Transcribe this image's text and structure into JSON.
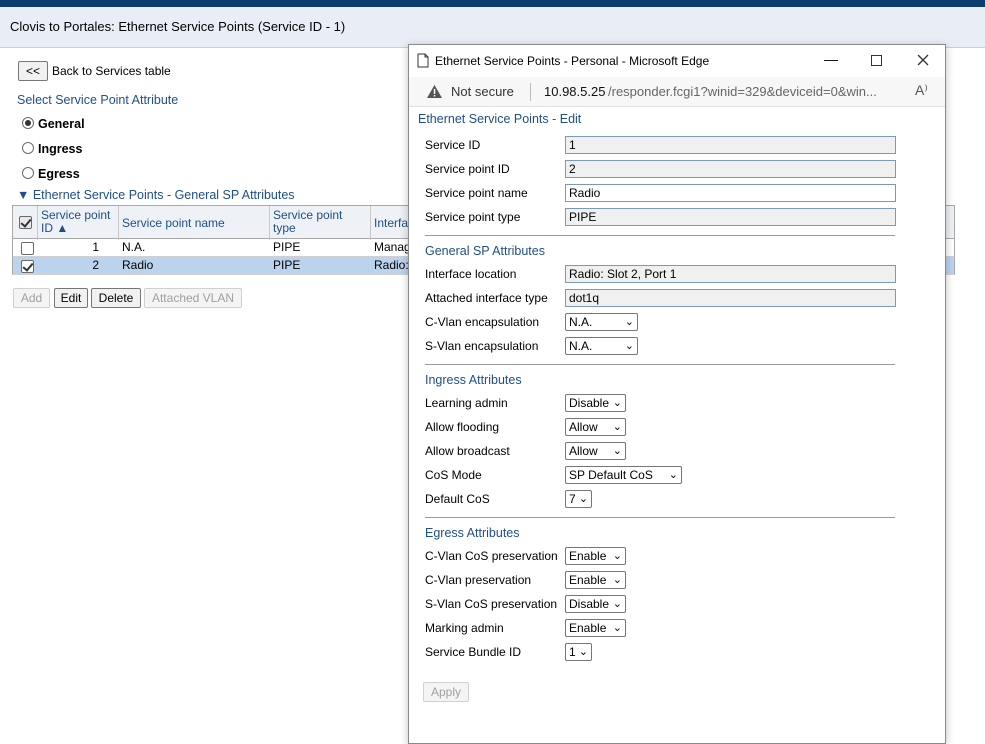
{
  "page": {
    "title": "Clovis to Portales: Ethernet Service Points (Service ID - 1)",
    "back_button": "<<",
    "back_label": "Back to Services table",
    "select_attr_title": "Select Service Point Attribute",
    "radios": [
      {
        "label": "General",
        "selected": true
      },
      {
        "label": "Ingress",
        "selected": false
      },
      {
        "label": "Egress",
        "selected": false
      }
    ],
    "section_title": "▼ Ethernet Service Points - General SP Attributes",
    "table": {
      "headers": [
        "Service point ID ▲",
        "Service point name",
        "Service point type",
        "Interfa"
      ],
      "header_line1": [
        "Service point",
        "Service point name",
        "Service point",
        "Interfa"
      ],
      "header_line2": [
        "ID ▲",
        "",
        "type",
        ""
      ],
      "rows": [
        {
          "checked": false,
          "id": "1",
          "name": "N.A.",
          "type": "PIPE",
          "iface": "Manag"
        },
        {
          "checked": true,
          "id": "2",
          "name": "Radio",
          "type": "PIPE",
          "iface": "Radio:"
        }
      ]
    },
    "actions": {
      "add": "Add",
      "edit": "Edit",
      "delete": "Delete",
      "attached_vlan": "Attached VLAN"
    }
  },
  "popup": {
    "window_title": "Ethernet Service Points - Personal - Microsoft Edge",
    "not_secure": "Not secure",
    "url_host": "10.98.5.25",
    "url_path": "/responder.fcgi1?winid=329&deviceid=0&win...",
    "heading": "Ethernet Service Points - Edit",
    "service_id_label": "Service ID",
    "service_id": "1",
    "sp_id_label": "Service point ID",
    "sp_id": "2",
    "sp_name_label": "Service point name",
    "sp_name": "Radio",
    "sp_type_label": "Service point type",
    "sp_type": "PIPE",
    "general_title": "General SP Attributes",
    "iface_loc_label": "Interface location",
    "iface_loc": "Radio: Slot 2, Port 1",
    "att_iface_label": "Attached interface type",
    "att_iface": "dot1q",
    "cvlan_enc_label": "C-Vlan encapsulation",
    "cvlan_enc": "N.A.",
    "svlan_enc_label": "S-Vlan encapsulation",
    "svlan_enc": "N.A.",
    "ingress_title": "Ingress Attributes",
    "learning_label": "Learning admin",
    "learning": "Disable",
    "flooding_label": "Allow flooding",
    "flooding": "Allow",
    "broadcast_label": "Allow broadcast",
    "broadcast": "Allow",
    "cos_mode_label": "CoS Mode",
    "cos_mode": "SP Default CoS",
    "default_cos_label": "Default CoS",
    "default_cos": "7",
    "egress_title": "Egress Attributes",
    "cvlan_cos_pres_label": "C-Vlan CoS preservation",
    "cvlan_cos_pres": "Enable",
    "cvlan_pres_label": "C-Vlan preservation",
    "cvlan_pres": "Enable",
    "svlan_cos_pres_label": "S-Vlan CoS preservation",
    "svlan_cos_pres": "Disable",
    "marking_label": "Marking admin",
    "marking": "Enable",
    "bundle_label": "Service Bundle ID",
    "bundle": "1",
    "apply": "Apply"
  },
  "colors": {
    "header_bar": "#0b3d6e",
    "accent_text": "#1f4e8c",
    "selected_row": "#bcd3ee"
  }
}
